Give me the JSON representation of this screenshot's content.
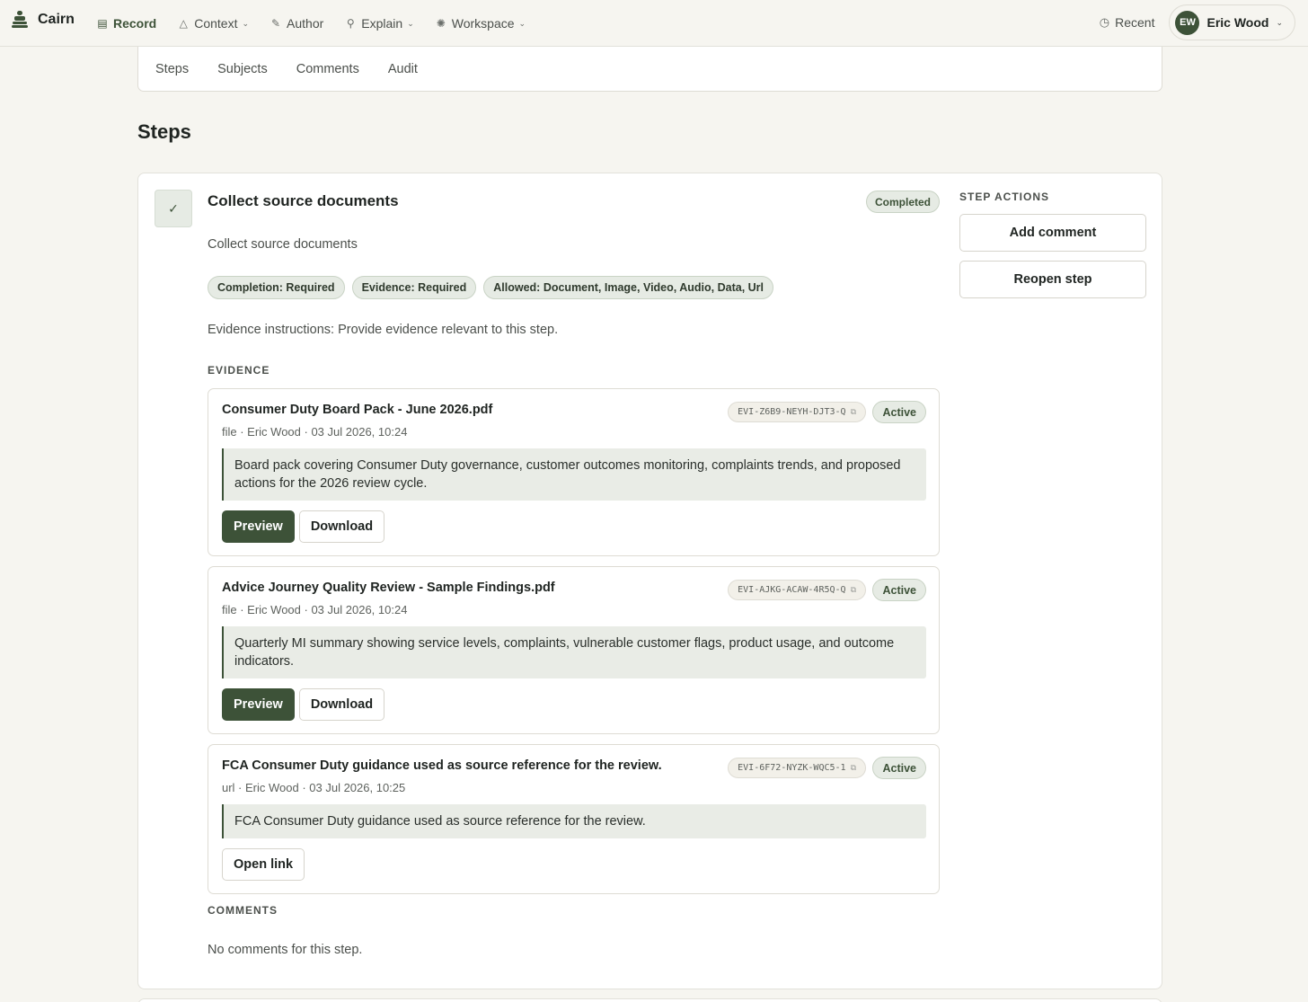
{
  "app": {
    "name": "Cairn",
    "logo_icon": "cairn-stack-icon"
  },
  "nav": {
    "items": [
      {
        "label": "Record",
        "icon": "clipboard-icon",
        "active": true,
        "dropdown": false
      },
      {
        "label": "Context",
        "icon": "triangle-icon",
        "active": false,
        "dropdown": true
      },
      {
        "label": "Author",
        "icon": "pencil-icon",
        "active": false,
        "dropdown": false
      },
      {
        "label": "Explain",
        "icon": "search-icon",
        "active": false,
        "dropdown": true
      },
      {
        "label": "Workspace",
        "icon": "gear-icon",
        "active": false,
        "dropdown": true
      }
    ],
    "recent_label": "Recent",
    "user": {
      "initials": "EW",
      "name": "Eric Wood"
    }
  },
  "tabs": [
    "Steps",
    "Subjects",
    "Comments",
    "Audit"
  ],
  "page_title": "Steps",
  "step": {
    "title": "Collect source documents",
    "status": "Completed",
    "description": "Collect source documents",
    "chips": [
      "Completion: Required",
      "Evidence: Required",
      "Allowed: Document, Image, Video, Audio, Data, Url"
    ],
    "instructions": "Evidence instructions: Provide evidence relevant to this step.",
    "evidence_label": "EVIDENCE",
    "evidence": [
      {
        "title": "Consumer Duty Board Pack - June 2026.pdf",
        "id": "EVI-Z6B9-NEYH-DJT3-Q",
        "status": "Active",
        "meta": "file · Eric Wood · 03 Jul 2026, 10:24",
        "note": "Board pack covering Consumer Duty governance, customer outcomes monitoring, complaints trends, and proposed actions for the 2026 review cycle.",
        "actions": [
          "Preview",
          "Download"
        ]
      },
      {
        "title": "Advice Journey Quality Review - Sample Findings.pdf",
        "id": "EVI-AJKG-ACAW-4R5Q-Q",
        "status": "Active",
        "meta": "file · Eric Wood · 03 Jul 2026, 10:24",
        "note": "Quarterly MI summary showing service levels, complaints, vulnerable customer flags, product usage, and outcome indicators.",
        "actions": [
          "Preview",
          "Download"
        ]
      },
      {
        "title": "FCA Consumer Duty guidance used as source reference for the review.",
        "id": "EVI-6F72-NYZK-WQC5-1",
        "status": "Active",
        "meta": "url · Eric Wood · 03 Jul 2026, 10:25",
        "note": "FCA Consumer Duty guidance used as source reference for the review.",
        "actions": [
          "Open link"
        ]
      }
    ],
    "comments_label": "COMMENTS",
    "no_comments": "No comments for this step.",
    "actions_label": "STEP ACTIONS",
    "actions": [
      "Add comment",
      "Reopen step"
    ]
  },
  "colors": {
    "accent": "#3d5238",
    "page_bg": "#f6f5f0",
    "chip_bg": "#e6ebe4"
  }
}
